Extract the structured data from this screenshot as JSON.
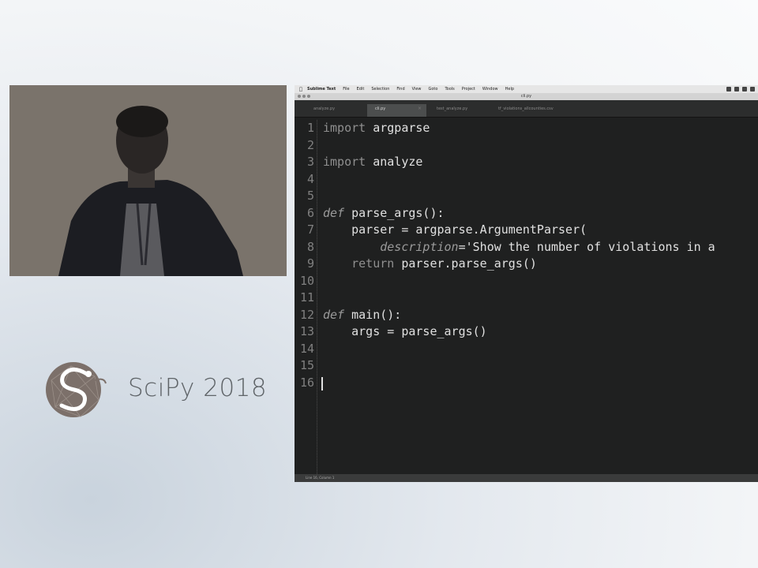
{
  "logo": {
    "text": "SciPy 2018",
    "icon": "scipy-snake-logo-icon"
  },
  "webcam": {
    "description_icon": "speaker-video-feed"
  },
  "editor": {
    "menubar": {
      "apple_icon": "apple-icon",
      "items": [
        "Sublime Text",
        "File",
        "Edit",
        "Selection",
        "Find",
        "View",
        "Goto",
        "Tools",
        "Project",
        "Window",
        "Help"
      ]
    },
    "window_title": "cli.py",
    "tabs": [
      {
        "label": "analyze.py",
        "active": false
      },
      {
        "label": "cli.py",
        "active": true
      },
      {
        "label": "test_analyze.py",
        "active": false
      },
      {
        "label": "tf_violations_allcounties.csv",
        "active": false
      }
    ],
    "code_lines": [
      {
        "n": "1",
        "parts": [
          {
            "t": "import",
            "c": "kw"
          },
          {
            "t": " argparse",
            "c": ""
          }
        ]
      },
      {
        "n": "2",
        "parts": []
      },
      {
        "n": "3",
        "parts": [
          {
            "t": "import",
            "c": "kw"
          },
          {
            "t": " analyze",
            "c": ""
          }
        ]
      },
      {
        "n": "4",
        "parts": []
      },
      {
        "n": "5",
        "parts": []
      },
      {
        "n": "6",
        "parts": [
          {
            "t": "def",
            "c": "kwi"
          },
          {
            "t": " parse_args():",
            "c": ""
          }
        ]
      },
      {
        "n": "7",
        "parts": [
          {
            "t": "    parser = argparse.ArgumentParser(",
            "c": ""
          }
        ]
      },
      {
        "n": "8",
        "parts": [
          {
            "t": "        ",
            "c": ""
          },
          {
            "t": "description",
            "c": "kwi"
          },
          {
            "t": "='Show the number of violations in a",
            "c": ""
          }
        ]
      },
      {
        "n": "9",
        "parts": [
          {
            "t": "    ",
            "c": ""
          },
          {
            "t": "return",
            "c": "kw"
          },
          {
            "t": " parser.parse_args()",
            "c": ""
          }
        ]
      },
      {
        "n": "10",
        "parts": []
      },
      {
        "n": "11",
        "parts": []
      },
      {
        "n": "12",
        "parts": [
          {
            "t": "def",
            "c": "kwi"
          },
          {
            "t": " main():",
            "c": ""
          }
        ]
      },
      {
        "n": "13",
        "parts": [
          {
            "t": "    args = parse_args()",
            "c": ""
          }
        ]
      },
      {
        "n": "14",
        "parts": []
      },
      {
        "n": "15",
        "parts": []
      },
      {
        "n": "16",
        "parts": [],
        "cursor": true
      }
    ],
    "status": "Line 16, Column 1"
  }
}
